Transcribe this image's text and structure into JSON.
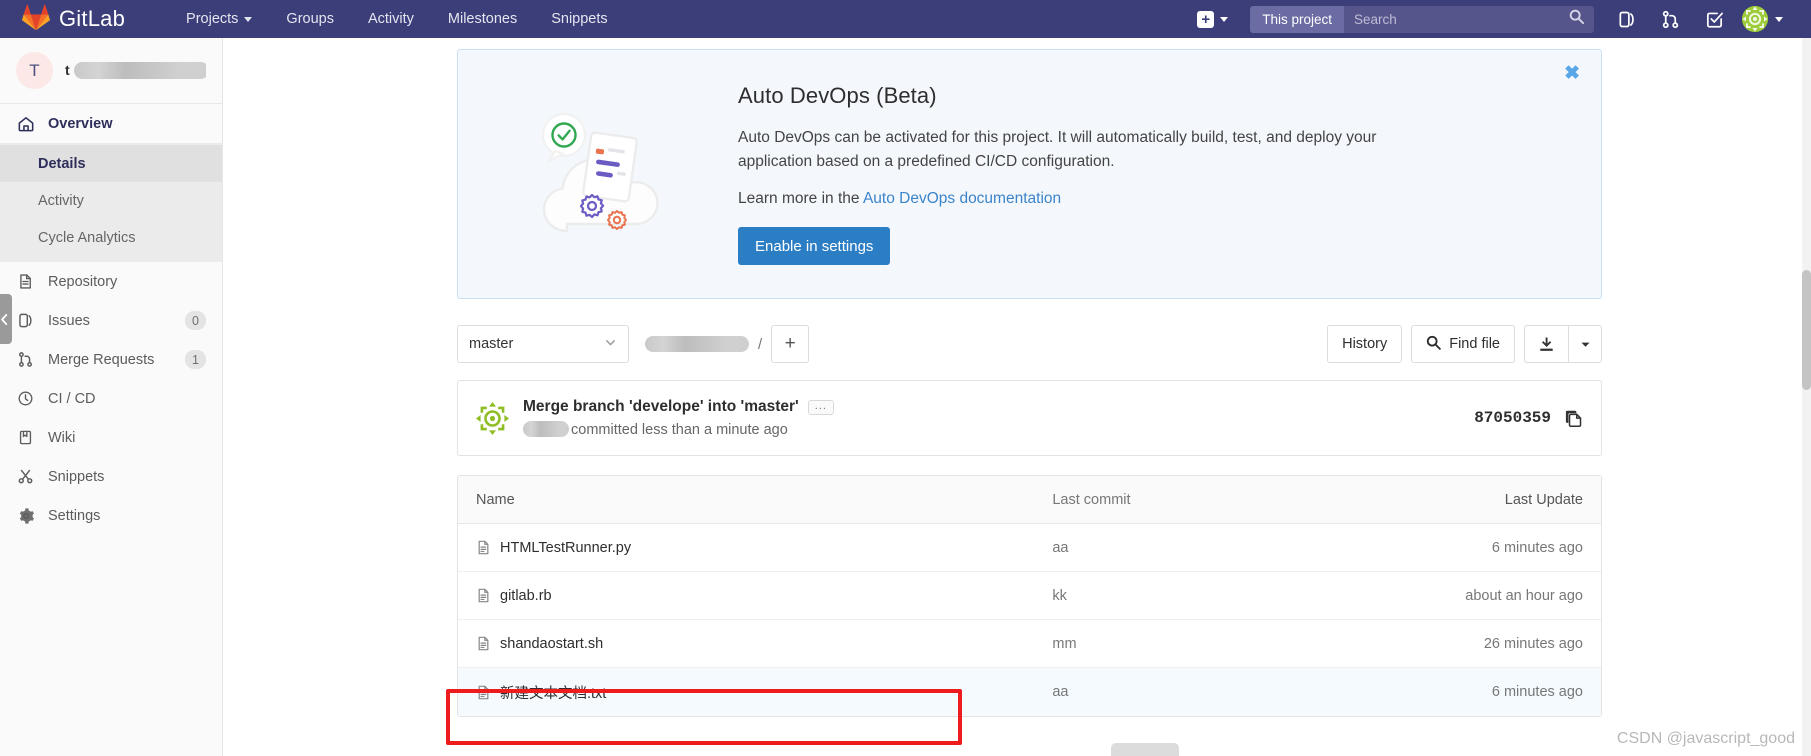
{
  "navbar": {
    "brand": "GitLab",
    "links": [
      {
        "label": "Projects",
        "caret": true
      },
      {
        "label": "Groups",
        "caret": false
      },
      {
        "label": "Activity",
        "caret": false
      },
      {
        "label": "Milestones",
        "caret": false
      },
      {
        "label": "Snippets",
        "caret": false
      }
    ],
    "plus_label": "+",
    "search_scope": "This project",
    "search_placeholder": "Search",
    "search_value": "",
    "icons": [
      "plus-icon",
      "search-icon",
      "issues-icon",
      "merge-requests-icon",
      "todos-icon",
      "user-avatar"
    ]
  },
  "sidebar": {
    "project_initial": "T",
    "project_name_visible": "t",
    "items": [
      {
        "label": "Overview",
        "icon": "home-icon",
        "active": true,
        "badge": ""
      },
      {
        "label": "Repository",
        "icon": "document-icon",
        "active": false,
        "badge": ""
      },
      {
        "label": "Issues",
        "icon": "issues-icon",
        "active": false,
        "badge": "0"
      },
      {
        "label": "Merge Requests",
        "icon": "merge-requests-icon",
        "active": false,
        "badge": "1"
      },
      {
        "label": "CI / CD",
        "icon": "rocket-icon",
        "active": false,
        "badge": ""
      },
      {
        "label": "Wiki",
        "icon": "book-icon",
        "active": false,
        "badge": ""
      },
      {
        "label": "Snippets",
        "icon": "scissors-icon",
        "active": false,
        "badge": ""
      },
      {
        "label": "Settings",
        "icon": "gear-icon",
        "active": false,
        "badge": ""
      }
    ],
    "subitems": [
      {
        "label": "Details",
        "current": true
      },
      {
        "label": "Activity",
        "current": false
      },
      {
        "label": "Cycle Analytics",
        "current": false
      }
    ]
  },
  "banner": {
    "close_label": "✖",
    "title": "Auto DevOps (Beta)",
    "description": "Auto DevOps can be activated for this project. It will automatically build, test, and deploy your application based on a predefined CI/CD configuration.",
    "learn_prefix": "Learn more in the ",
    "learn_link": "Auto DevOps documentation",
    "button_label": "Enable in settings",
    "accent_color": "#2c7ec4",
    "background_color": "#f4f8fd",
    "border_color": "#c9e1f5"
  },
  "repo_toolbar": {
    "branch": "master",
    "path_separator": "/",
    "add_label": "+",
    "history_label": "History",
    "find_file_label": "Find file",
    "download_icon": "download-icon"
  },
  "commit": {
    "message": "Merge branch 'develope' into 'master'",
    "expand_label": "...",
    "meta_suffix": "committed less than a minute ago",
    "sha": "87050359",
    "copy_icon": "copy-icon"
  },
  "file_table": {
    "columns": {
      "name": "Name",
      "last_commit": "Last commit",
      "last_update": "Last Update"
    },
    "rows": [
      {
        "name": "HTMLTestRunner.py",
        "last_commit": "aa",
        "last_update": "6 minutes ago",
        "highlight": false
      },
      {
        "name": "gitlab.rb",
        "last_commit": "kk",
        "last_update": "about an hour ago",
        "highlight": false
      },
      {
        "name": "shandaostart.sh",
        "last_commit": "mm",
        "last_update": "26 minutes ago",
        "highlight": false
      },
      {
        "name": "新建文本文档.txt",
        "last_commit": "aa",
        "last_update": "6 minutes ago",
        "highlight": true
      }
    ]
  },
  "annotation": {
    "color": "#ee1c1c",
    "target": "新建文本文档.txt"
  },
  "watermark": {
    "text": "CSDN @javascript_good"
  }
}
